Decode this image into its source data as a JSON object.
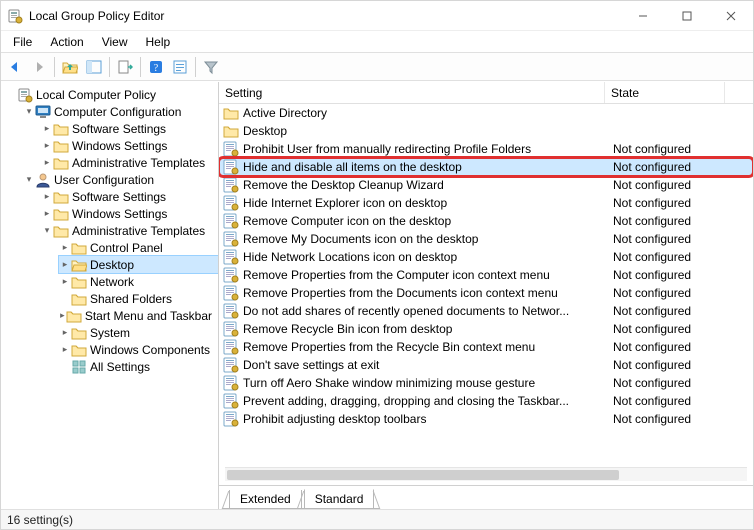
{
  "window": {
    "title": "Local Group Policy Editor"
  },
  "menu": [
    "File",
    "Action",
    "View",
    "Help"
  ],
  "columns": {
    "setting": "Setting",
    "state": "State"
  },
  "columnWidths": {
    "setting": 386,
    "state": 120
  },
  "tree": {
    "root": "Local Computer Policy",
    "cc": "Computer Configuration",
    "cc_ss": "Software Settings",
    "cc_ws": "Windows Settings",
    "cc_at": "Administrative Templates",
    "uc": "User Configuration",
    "uc_ss": "Software Settings",
    "uc_ws": "Windows Settings",
    "uc_at": "Administrative Templates",
    "cp": "Control Panel",
    "dk": "Desktop",
    "nw": "Network",
    "sf": "Shared Folders",
    "sm": "Start Menu and Taskbar",
    "sy": "System",
    "wc": "Windows Components",
    "as": "All Settings"
  },
  "rows": [
    {
      "icon": "folder",
      "setting": "Active Directory",
      "state": ""
    },
    {
      "icon": "folder",
      "setting": "Desktop",
      "state": ""
    },
    {
      "icon": "setting",
      "setting": "Prohibit User from manually redirecting Profile Folders",
      "state": "Not configured"
    },
    {
      "icon": "setting",
      "setting": "Hide and disable all items on the desktop",
      "state": "Not configured",
      "selected": true,
      "highlighted": true
    },
    {
      "icon": "setting",
      "setting": "Remove the Desktop Cleanup Wizard",
      "state": "Not configured"
    },
    {
      "icon": "setting",
      "setting": "Hide Internet Explorer icon on desktop",
      "state": "Not configured"
    },
    {
      "icon": "setting",
      "setting": "Remove Computer icon on the desktop",
      "state": "Not configured"
    },
    {
      "icon": "setting",
      "setting": "Remove My Documents icon on the desktop",
      "state": "Not configured"
    },
    {
      "icon": "setting",
      "setting": "Hide Network Locations icon on desktop",
      "state": "Not configured"
    },
    {
      "icon": "setting",
      "setting": "Remove Properties from the Computer icon context menu",
      "state": "Not configured"
    },
    {
      "icon": "setting",
      "setting": "Remove Properties from the Documents icon context menu",
      "state": "Not configured"
    },
    {
      "icon": "setting",
      "setting": "Do not add shares of recently opened documents to Networ...",
      "state": "Not configured"
    },
    {
      "icon": "setting",
      "setting": "Remove Recycle Bin icon from desktop",
      "state": "Not configured"
    },
    {
      "icon": "setting",
      "setting": "Remove Properties from the Recycle Bin context menu",
      "state": "Not configured"
    },
    {
      "icon": "setting",
      "setting": "Don't save settings at exit",
      "state": "Not configured"
    },
    {
      "icon": "setting",
      "setting": "Turn off Aero Shake window minimizing mouse gesture",
      "state": "Not configured"
    },
    {
      "icon": "setting",
      "setting": "Prevent adding, dragging, dropping and closing the Taskbar...",
      "state": "Not configured"
    },
    {
      "icon": "setting",
      "setting": "Prohibit adjusting desktop toolbars",
      "state": "Not configured"
    }
  ],
  "tabs": {
    "extended": "Extended",
    "standard": "Standard"
  },
  "status": "16 setting(s)"
}
